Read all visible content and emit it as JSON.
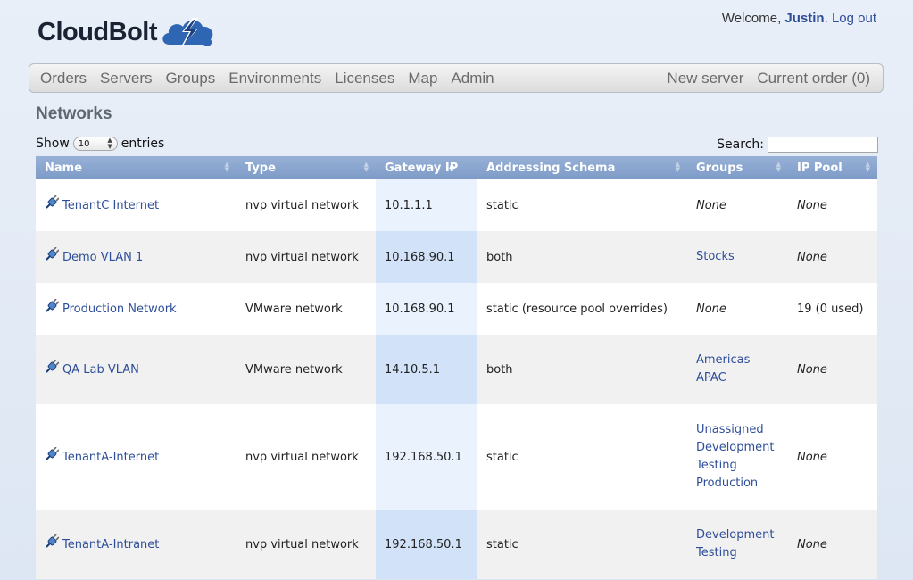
{
  "header": {
    "logo_text": "CloudBolt",
    "welcome_prefix": "Welcome,",
    "user": "Justin",
    "logout": "Log out"
  },
  "nav": {
    "left": [
      "Orders",
      "Servers",
      "Groups",
      "Environments",
      "Licenses",
      "Map",
      "Admin"
    ],
    "right": [
      "New server",
      "Current order (0)"
    ]
  },
  "page": {
    "title": "Networks"
  },
  "controls": {
    "show_label": "Show",
    "entries_value": "10",
    "entries_label": "entries",
    "search_label": "Search:",
    "search_value": ""
  },
  "table": {
    "columns": [
      "Name",
      "Type",
      "Gateway IP",
      "Addressing Schema",
      "Groups",
      "IP Pool"
    ],
    "sorted_column": "Gateway IP",
    "rows": [
      {
        "name": "TenantC Internet",
        "type": "nvp virtual network",
        "gateway": "10.1.1.1",
        "schema": "static",
        "groups": [],
        "groups_none": "None",
        "pool": "None"
      },
      {
        "name": "Demo VLAN 1",
        "type": "nvp virtual network",
        "gateway": "10.168.90.1",
        "schema": "both",
        "groups": [
          "Stocks"
        ],
        "groups_none": "",
        "pool": "None"
      },
      {
        "name": "Production Network",
        "type": "VMware network",
        "gateway": "10.168.90.1",
        "schema": "static (resource pool overrides)",
        "groups": [],
        "groups_none": "None",
        "pool": "19 (0 used)"
      },
      {
        "name": "QA Lab VLAN",
        "type": "VMware network",
        "gateway": "14.10.5.1",
        "schema": "both",
        "groups": [
          "Americas",
          "APAC"
        ],
        "groups_none": "",
        "pool": "None"
      },
      {
        "name": "TenantA-Internet",
        "type": "nvp virtual network",
        "gateway": "192.168.50.1",
        "schema": "static",
        "groups": [
          "Unassigned",
          "Development",
          "Testing",
          "Production"
        ],
        "groups_none": "",
        "pool": "None"
      },
      {
        "name": "TenantA-Intranet",
        "type": "nvp virtual network",
        "gateway": "192.168.50.1",
        "schema": "static",
        "groups": [
          "Development",
          "Testing"
        ],
        "groups_none": "",
        "pool": "None"
      }
    ]
  },
  "colors": {
    "link": "#2e4e99",
    "header_bg": "#8aa6d0",
    "sorted_col_even": "#d2e3f9",
    "sorted_col_odd": "#eaf2fd"
  }
}
